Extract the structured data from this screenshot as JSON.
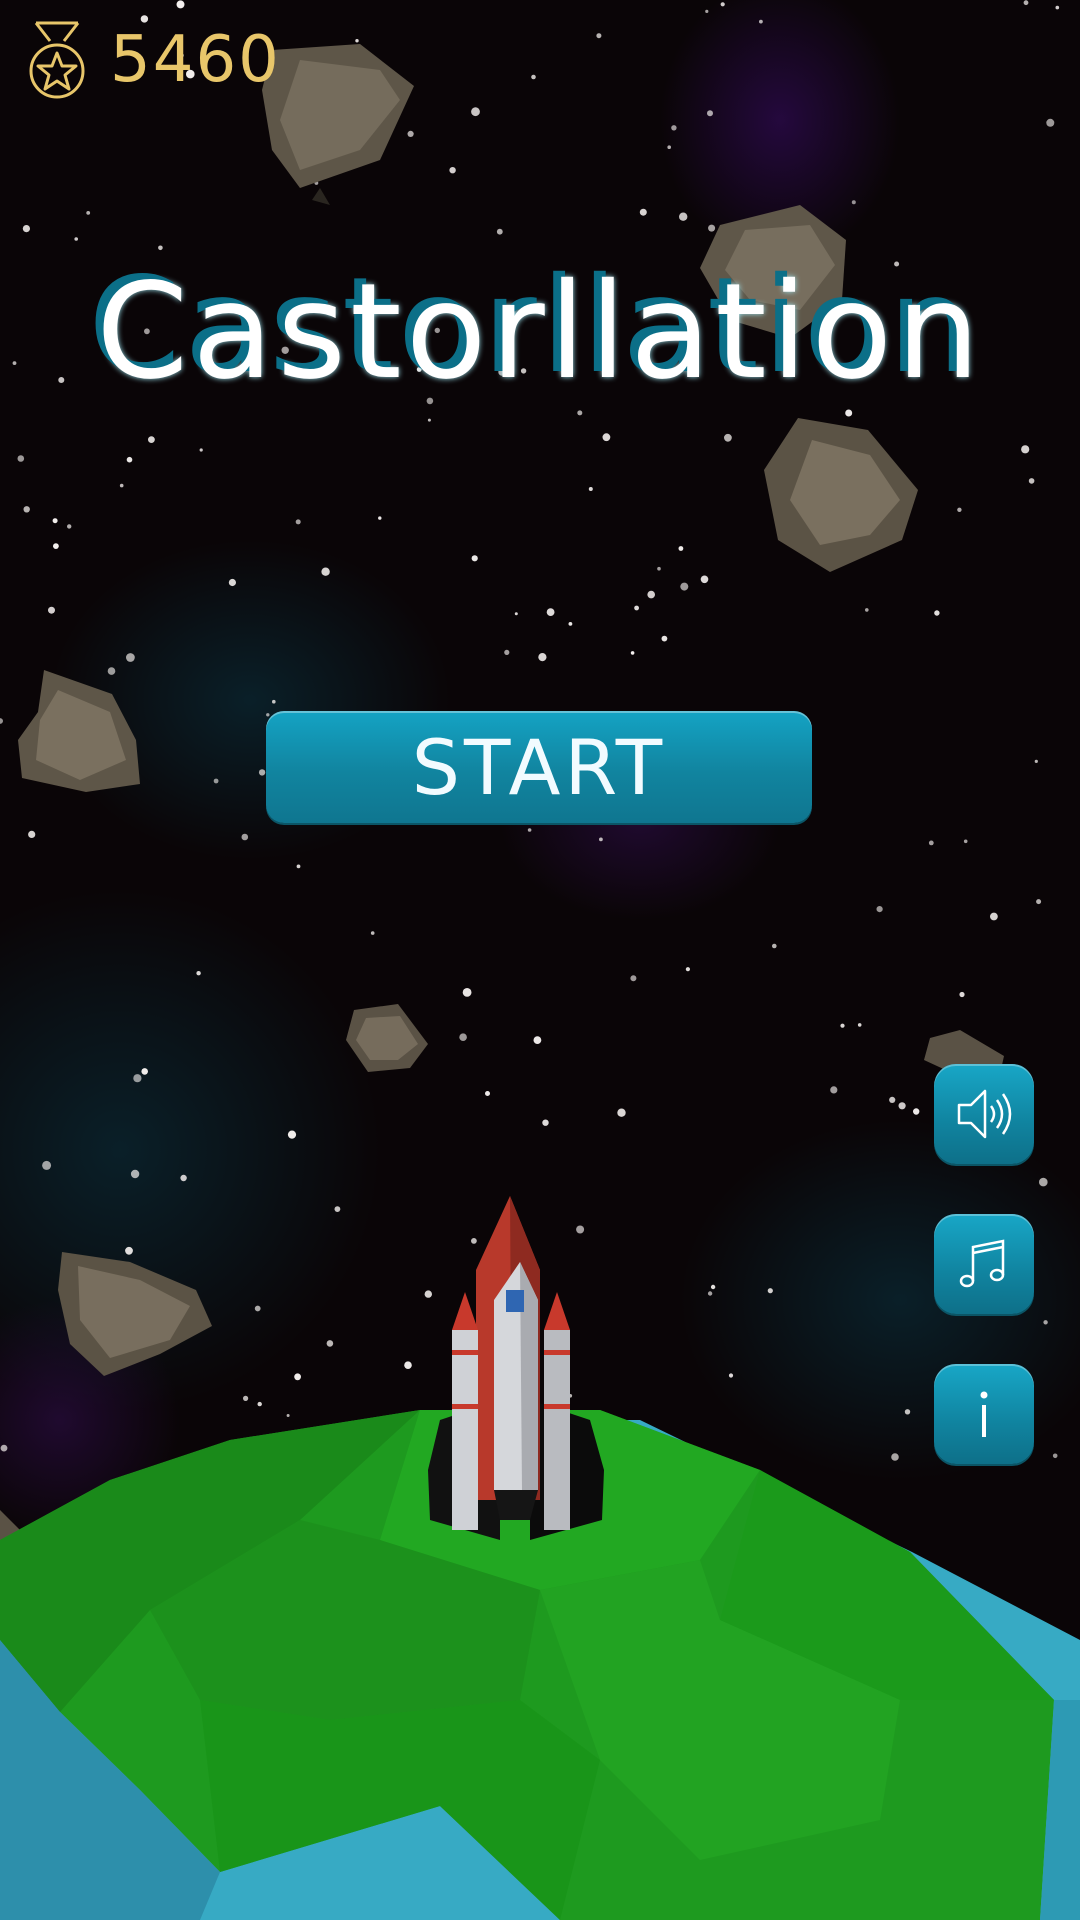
{
  "hud": {
    "score": "5460",
    "score_icon": "medal-star-icon",
    "score_color": "#e8c66a"
  },
  "title": {
    "text": "Castorllation",
    "color": "#ffffff",
    "shadow_color": "#0b6f88"
  },
  "start_button": {
    "label": "START",
    "color": "#1290af"
  },
  "side_buttons": [
    {
      "name": "sound-button",
      "icon": "speaker-icon"
    },
    {
      "name": "music-button",
      "icon": "music-note-icon"
    },
    {
      "name": "info-button",
      "icon": "info-icon"
    }
  ],
  "scene": {
    "background": "#0a0507",
    "planet_colors": {
      "land": "#1f9a1f",
      "water": "#3aafc8"
    },
    "rocket_colors": {
      "tip": "#c8392c",
      "body": "#c9cbd0",
      "wings": "#111111"
    }
  }
}
